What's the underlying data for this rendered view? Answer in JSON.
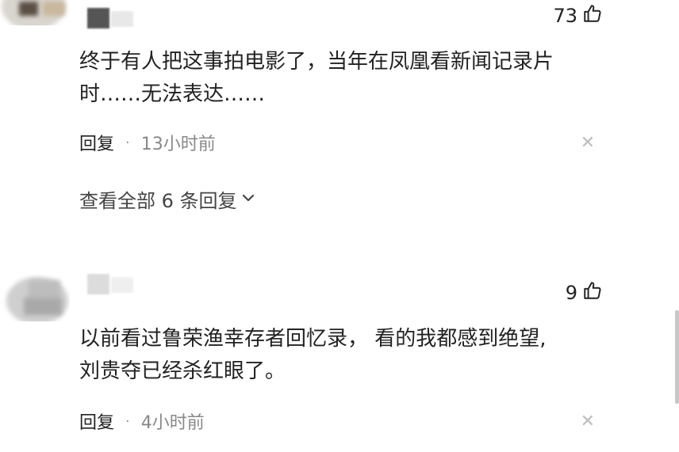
{
  "comments": [
    {
      "likes": "73",
      "text_line1": "终于有人把这事拍电影了，当年在凤凰看新闻记录片",
      "text_line2": "时……无法表达……",
      "reply_label": "回复",
      "time": "13小时前",
      "view_replies_label": "查看全部 6 条回复"
    },
    {
      "likes": "9",
      "text_line1": "以前看过鲁荣渔幸存者回忆录， 看的我都感到绝望,",
      "text_line2": "刘贵夺已经杀红眼了。",
      "reply_label": "回复",
      "time": "4小时前"
    }
  ],
  "icons": {
    "like": "thumbs-up-icon",
    "close": "close-icon",
    "expand": "chevron-down-icon"
  },
  "colors": {
    "text": "#222222",
    "muted": "#888888",
    "close": "#bdbdbd"
  }
}
